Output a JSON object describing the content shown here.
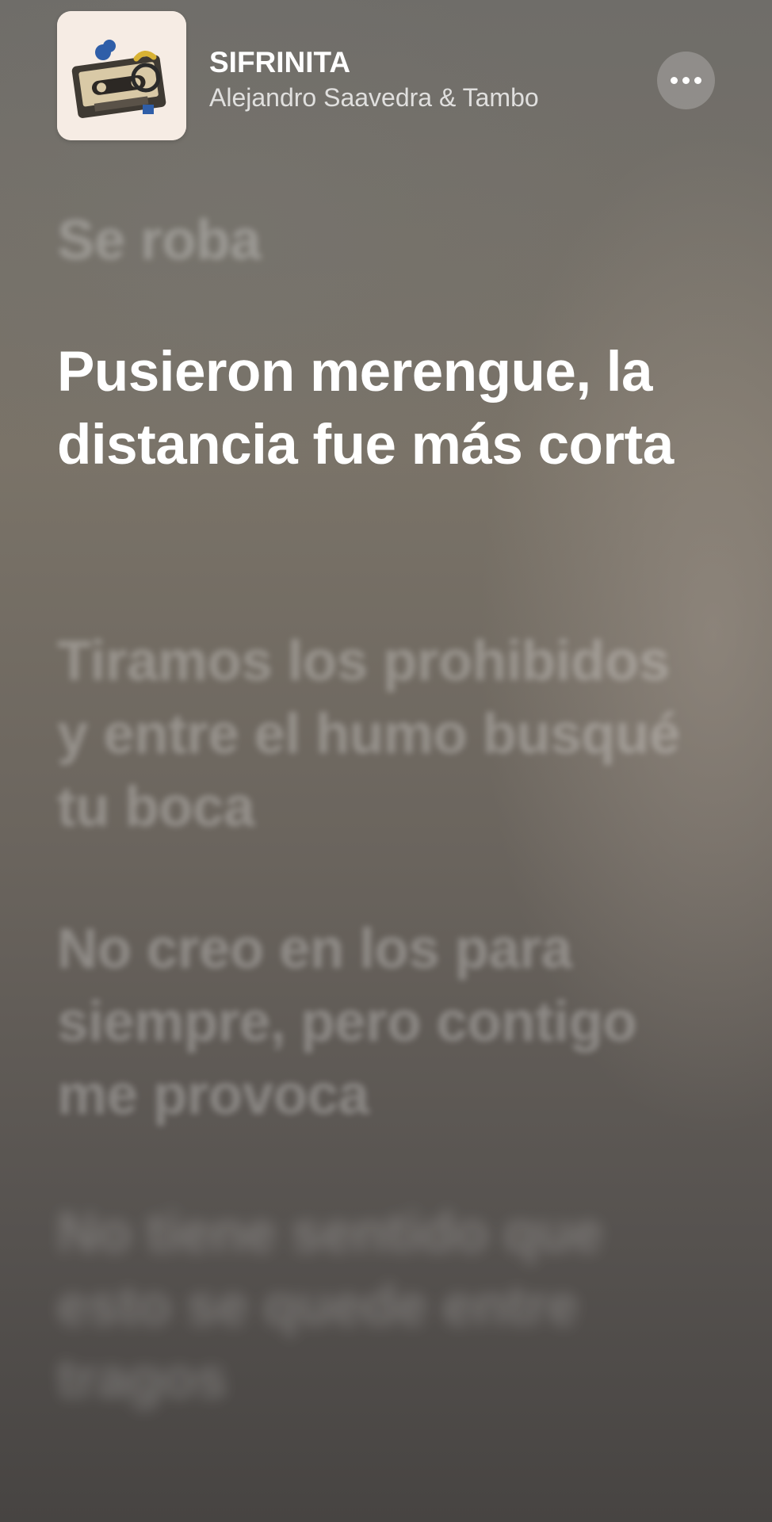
{
  "now_playing": {
    "title": "SIFRINITA",
    "artist": "Alejandro Saavedra & Tambo",
    "artwork_icon": "album-art-cassette",
    "more_icon": "ellipsis-icon"
  },
  "lyrics": {
    "lines": [
      "Se roba",
      "Pusieron merengue, la distancia fue más corta",
      "Tiramos los prohibidos y entre el humo busqué tu boca",
      "No creo en los para siempre, pero contigo me provoca",
      "No tiene sentido que esto se quede entre tragos"
    ],
    "active_index": 1
  },
  "colors": {
    "active_text": "#ffffff",
    "inactive_text": "rgba(255,255,255,0.28)",
    "background_top": "#6f6d69",
    "background_bottom": "#474442"
  }
}
